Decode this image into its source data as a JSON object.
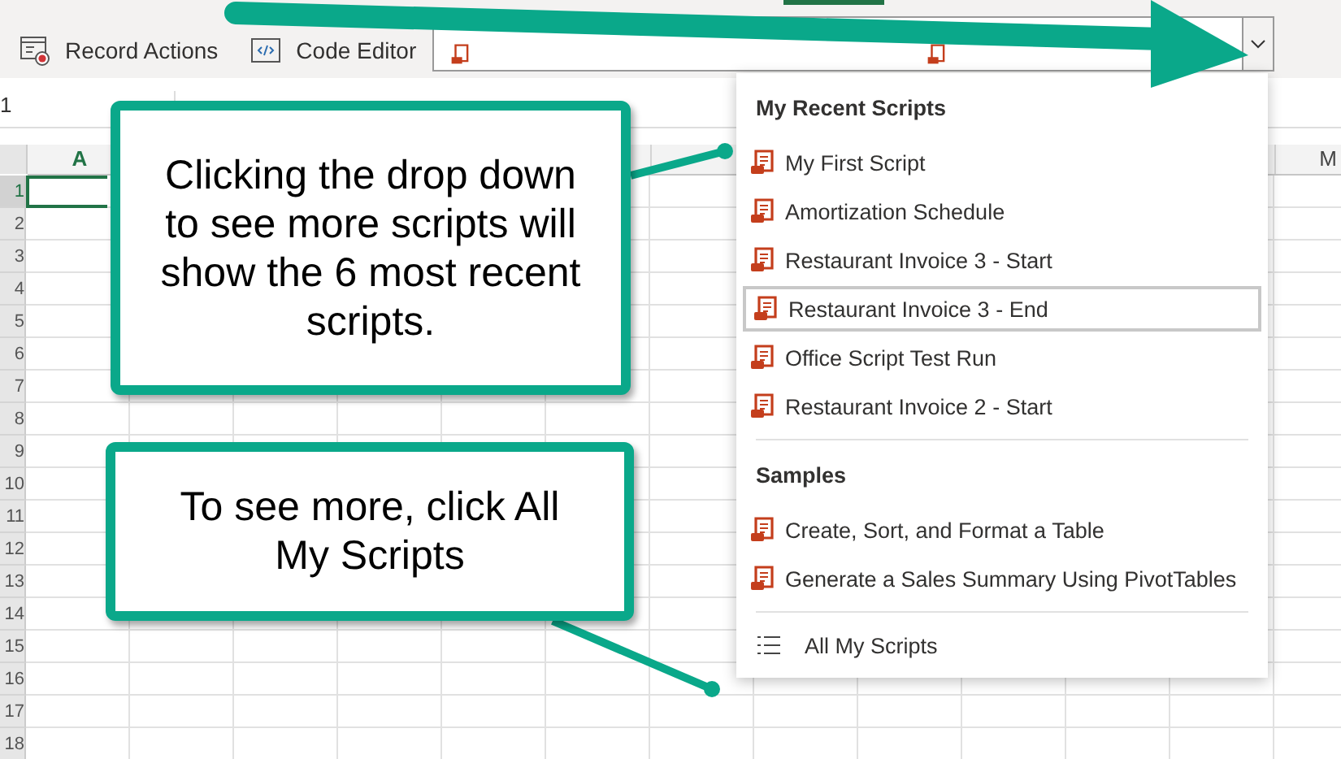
{
  "toolbar": {
    "buttons": [
      {
        "kind": "record",
        "label": "Record Actions"
      },
      {
        "kind": "code",
        "label": "Code Editor"
      }
    ]
  },
  "name_box": {
    "value": "1"
  },
  "sheet": {
    "column_headers": [
      {
        "label": "A",
        "selected": true
      },
      {
        "label": "M",
        "selected": false
      }
    ],
    "row_headers": [
      {
        "label": "1",
        "selected": true
      },
      {
        "label": "2",
        "selected": false
      },
      {
        "label": "3",
        "selected": false
      },
      {
        "label": "4",
        "selected": false
      },
      {
        "label": "5",
        "selected": false
      },
      {
        "label": "6",
        "selected": false
      },
      {
        "label": "7",
        "selected": false
      },
      {
        "label": "8",
        "selected": false
      },
      {
        "label": "9",
        "selected": false
      },
      {
        "label": "10",
        "selected": false
      },
      {
        "label": "11",
        "selected": false
      },
      {
        "label": "12",
        "selected": false
      },
      {
        "label": "13",
        "selected": false
      },
      {
        "label": "14",
        "selected": false
      },
      {
        "label": "15",
        "selected": false
      },
      {
        "label": "16",
        "selected": false
      },
      {
        "label": "17",
        "selected": false
      },
      {
        "label": "18",
        "selected": false
      }
    ]
  },
  "script_menu": {
    "sections": [
      {
        "title": "My Recent Scripts",
        "items": [
          {
            "label": "My First Script",
            "selected": false
          },
          {
            "label": "Amortization Schedule",
            "selected": false
          },
          {
            "label": "Restaurant Invoice 3 - Start",
            "selected": false
          },
          {
            "label": "Restaurant Invoice 3 - End",
            "selected": true
          },
          {
            "label": "Office Script Test Run",
            "selected": false
          },
          {
            "label": "Restaurant Invoice 2 - Start",
            "selected": false
          }
        ]
      },
      {
        "title": "Samples",
        "items": [
          {
            "label": "Create, Sort, and Format a Table",
            "selected": false
          },
          {
            "label": "Generate a Sales Summary Using PivotTables",
            "selected": false
          }
        ]
      }
    ],
    "footer": "All My Scripts"
  },
  "callouts": [
    "Clicking the drop down to see more scripts will show the 6 most recent scripts.",
    "To see more, click All My Scripts"
  ]
}
